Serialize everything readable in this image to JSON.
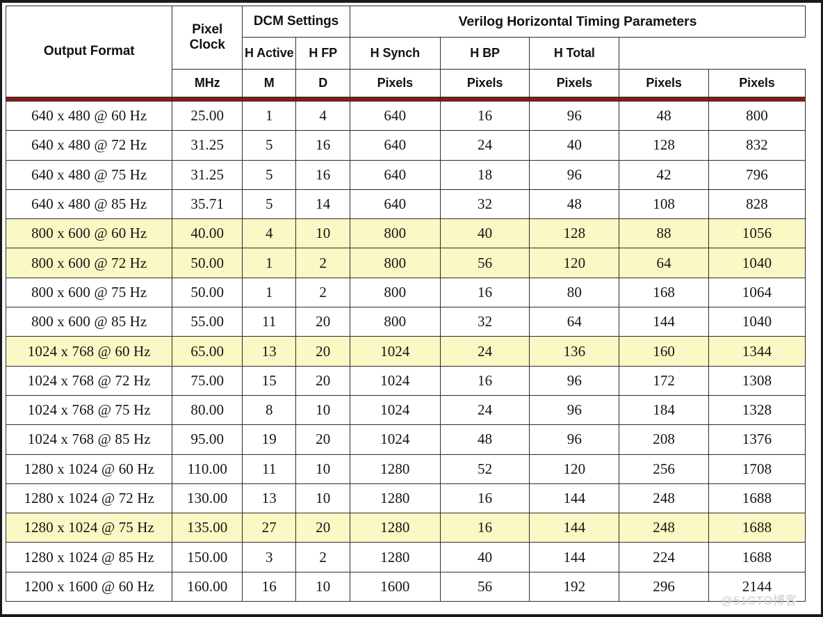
{
  "table": {
    "header": {
      "output_format": "Output Format",
      "pixel_clock": "Pixel Clock",
      "dcm_settings": "DCM Settings",
      "group_title": "Verilog Horizontal Timing Parameters",
      "sub": {
        "h_active": "H Active",
        "h_fp": "H FP",
        "h_synch": "H Synch",
        "h_bp": "H BP",
        "h_total": "H Total"
      },
      "units": {
        "mhz": "MHz",
        "m": "M",
        "d": "D",
        "pixels_h_active": "Pixels",
        "pixels_h_fp": "Pixels",
        "pixels_h_synch": "Pixels",
        "pixels_h_bp": "Pixels",
        "pixels_h_total": "Pixels"
      }
    },
    "rows": [
      {
        "format": "640 x 480 @ 60 Hz",
        "clock": "25.00",
        "m": "1",
        "d": "4",
        "h_active": "640",
        "h_fp": "16",
        "h_synch": "96",
        "h_bp": "48",
        "h_total": "800",
        "highlight": false
      },
      {
        "format": "640 x 480 @ 72 Hz",
        "clock": "31.25",
        "m": "5",
        "d": "16",
        "h_active": "640",
        "h_fp": "24",
        "h_synch": "40",
        "h_bp": "128",
        "h_total": "832",
        "highlight": false
      },
      {
        "format": "640 x 480 @ 75 Hz",
        "clock": "31.25",
        "m": "5",
        "d": "16",
        "h_active": "640",
        "h_fp": "18",
        "h_synch": "96",
        "h_bp": "42",
        "h_total": "796",
        "highlight": false
      },
      {
        "format": "640 x 480 @ 85 Hz",
        "clock": "35.71",
        "m": "5",
        "d": "14",
        "h_active": "640",
        "h_fp": "32",
        "h_synch": "48",
        "h_bp": "108",
        "h_total": "828",
        "highlight": false
      },
      {
        "format": "800 x 600 @ 60 Hz",
        "clock": "40.00",
        "m": "4",
        "d": "10",
        "h_active": "800",
        "h_fp": "40",
        "h_synch": "128",
        "h_bp": "88",
        "h_total": "1056",
        "highlight": true
      },
      {
        "format": "800 x 600 @ 72 Hz",
        "clock": "50.00",
        "m": "1",
        "d": "2",
        "h_active": "800",
        "h_fp": "56",
        "h_synch": "120",
        "h_bp": "64",
        "h_total": "1040",
        "highlight": true
      },
      {
        "format": "800 x 600 @ 75 Hz",
        "clock": "50.00",
        "m": "1",
        "d": "2",
        "h_active": "800",
        "h_fp": "16",
        "h_synch": "80",
        "h_bp": "168",
        "h_total": "1064",
        "highlight": false
      },
      {
        "format": "800 x 600 @ 85 Hz",
        "clock": "55.00",
        "m": "11",
        "d": "20",
        "h_active": "800",
        "h_fp": "32",
        "h_synch": "64",
        "h_bp": "144",
        "h_total": "1040",
        "highlight": false
      },
      {
        "format": "1024 x 768 @ 60 Hz",
        "clock": "65.00",
        "m": "13",
        "d": "20",
        "h_active": "1024",
        "h_fp": "24",
        "h_synch": "136",
        "h_bp": "160",
        "h_total": "1344",
        "highlight": true
      },
      {
        "format": "1024 x 768 @ 72 Hz",
        "clock": "75.00",
        "m": "15",
        "d": "20",
        "h_active": "1024",
        "h_fp": "16",
        "h_synch": "96",
        "h_bp": "172",
        "h_total": "1308",
        "highlight": false
      },
      {
        "format": "1024 x 768 @ 75 Hz",
        "clock": "80.00",
        "m": "8",
        "d": "10",
        "h_active": "1024",
        "h_fp": "24",
        "h_synch": "96",
        "h_bp": "184",
        "h_total": "1328",
        "highlight": false
      },
      {
        "format": "1024 x 768 @ 85 Hz",
        "clock": "95.00",
        "m": "19",
        "d": "20",
        "h_active": "1024",
        "h_fp": "48",
        "h_synch": "96",
        "h_bp": "208",
        "h_total": "1376",
        "highlight": false
      },
      {
        "format": "1280 x 1024 @ 60 Hz",
        "clock": "110.00",
        "m": "11",
        "d": "10",
        "h_active": "1280",
        "h_fp": "52",
        "h_synch": "120",
        "h_bp": "256",
        "h_total": "1708",
        "highlight": false
      },
      {
        "format": "1280 x 1024 @ 72 Hz",
        "clock": "130.00",
        "m": "13",
        "d": "10",
        "h_active": "1280",
        "h_fp": "16",
        "h_synch": "144",
        "h_bp": "248",
        "h_total": "1688",
        "highlight": false
      },
      {
        "format": "1280 x 1024 @ 75 Hz",
        "clock": "135.00",
        "m": "27",
        "d": "20",
        "h_active": "1280",
        "h_fp": "16",
        "h_synch": "144",
        "h_bp": "248",
        "h_total": "1688",
        "highlight": true
      },
      {
        "format": "1280 x 1024 @ 85 Hz",
        "clock": "150.00",
        "m": "3",
        "d": "2",
        "h_active": "1280",
        "h_fp": "40",
        "h_synch": "144",
        "h_bp": "224",
        "h_total": "1688",
        "highlight": false
      },
      {
        "format": "1200 x 1600 @ 60 Hz",
        "clock": "160.00",
        "m": "16",
        "d": "10",
        "h_active": "1600",
        "h_fp": "56",
        "h_synch": "192",
        "h_bp": "296",
        "h_total": "2144",
        "highlight": false
      }
    ]
  },
  "watermark": {
    "text": "@51CTO博客"
  },
  "colors": {
    "highlight_row": "#faf8c4",
    "header_rule": "#8b1a17",
    "border": "#2b2b2b",
    "outer_border": "#1a1a1a",
    "text": "#141414",
    "watermark": "#c9cfd4"
  }
}
